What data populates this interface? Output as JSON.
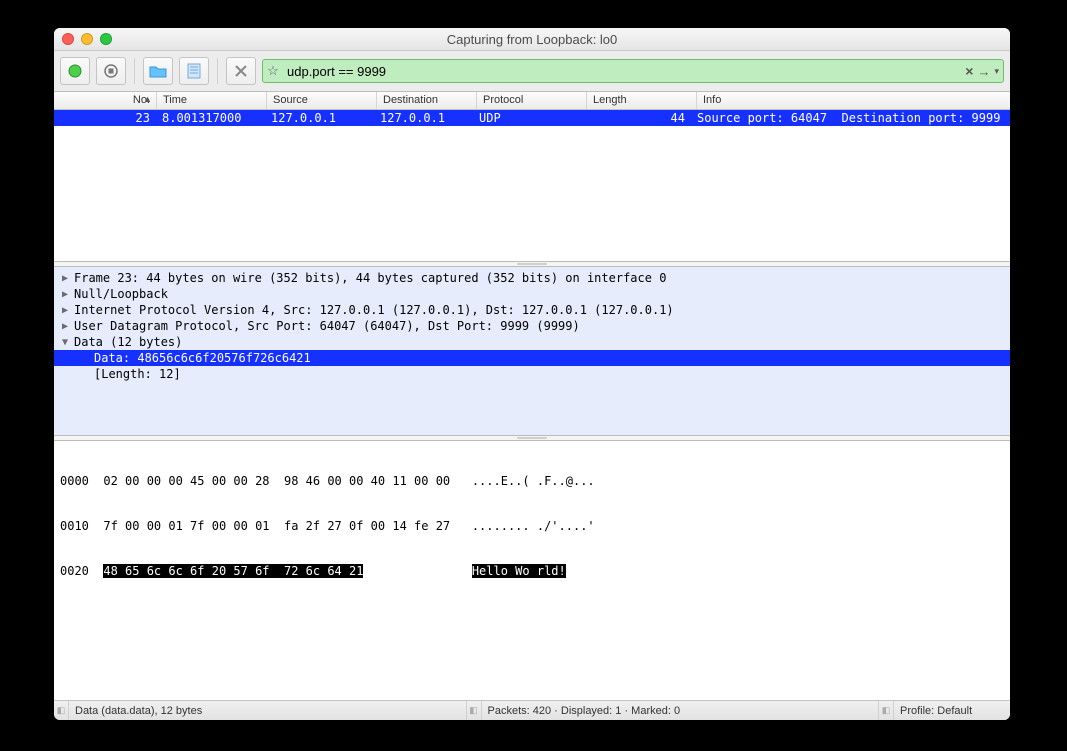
{
  "window": {
    "title": "Capturing from Loopback: lo0"
  },
  "filter": {
    "value": "udp.port == 9999"
  },
  "columns": {
    "no": "No.",
    "time": "Time",
    "src": "Source",
    "dst": "Destination",
    "pro": "Protocol",
    "len": "Length",
    "info": "Info"
  },
  "row": {
    "no": "23",
    "time": "8.001317000",
    "src": "127.0.0.1",
    "dst": "127.0.0.1",
    "pro": "UDP",
    "len": "44",
    "info": "Source port: 64047  Destination port: 9999"
  },
  "tree": {
    "l1": "Frame 23: 44 bytes on wire (352 bits), 44 bytes captured (352 bits) on interface 0",
    "l2": "Null/Loopback",
    "l3": "Internet Protocol Version 4, Src: 127.0.0.1 (127.0.0.1), Dst: 127.0.0.1 (127.0.0.1)",
    "l4": "User Datagram Protocol, Src Port: 64047 (64047), Dst Port: 9999 (9999)",
    "l5": "Data (12 bytes)",
    "l6": "Data: 48656c6c6f20576f726c6421",
    "l7": "[Length: 12]"
  },
  "hex": {
    "line0_off": "0000",
    "line0_hex": "02 00 00 00 45 00 00 28  98 46 00 00 40 11 00 00",
    "line0_asc": "....E..( .F..@...",
    "line1_off": "0010",
    "line1_hex": "7f 00 00 01 7f 00 00 01  fa 2f 27 0f 00 14 fe 27",
    "line1_asc": "........ ./'....'",
    "line2_off": "0020",
    "line2_hex": "48 65 6c 6c 6f 20 57 6f  72 6c 64 21",
    "line2_asc1": "Hello Wo ",
    "line2_asc2": "rld!"
  },
  "status": {
    "left": "Data (data.data), 12 bytes",
    "center": "Packets: 420 · Displayed: 1 · Marked: 0",
    "right": "Profile: Default"
  }
}
